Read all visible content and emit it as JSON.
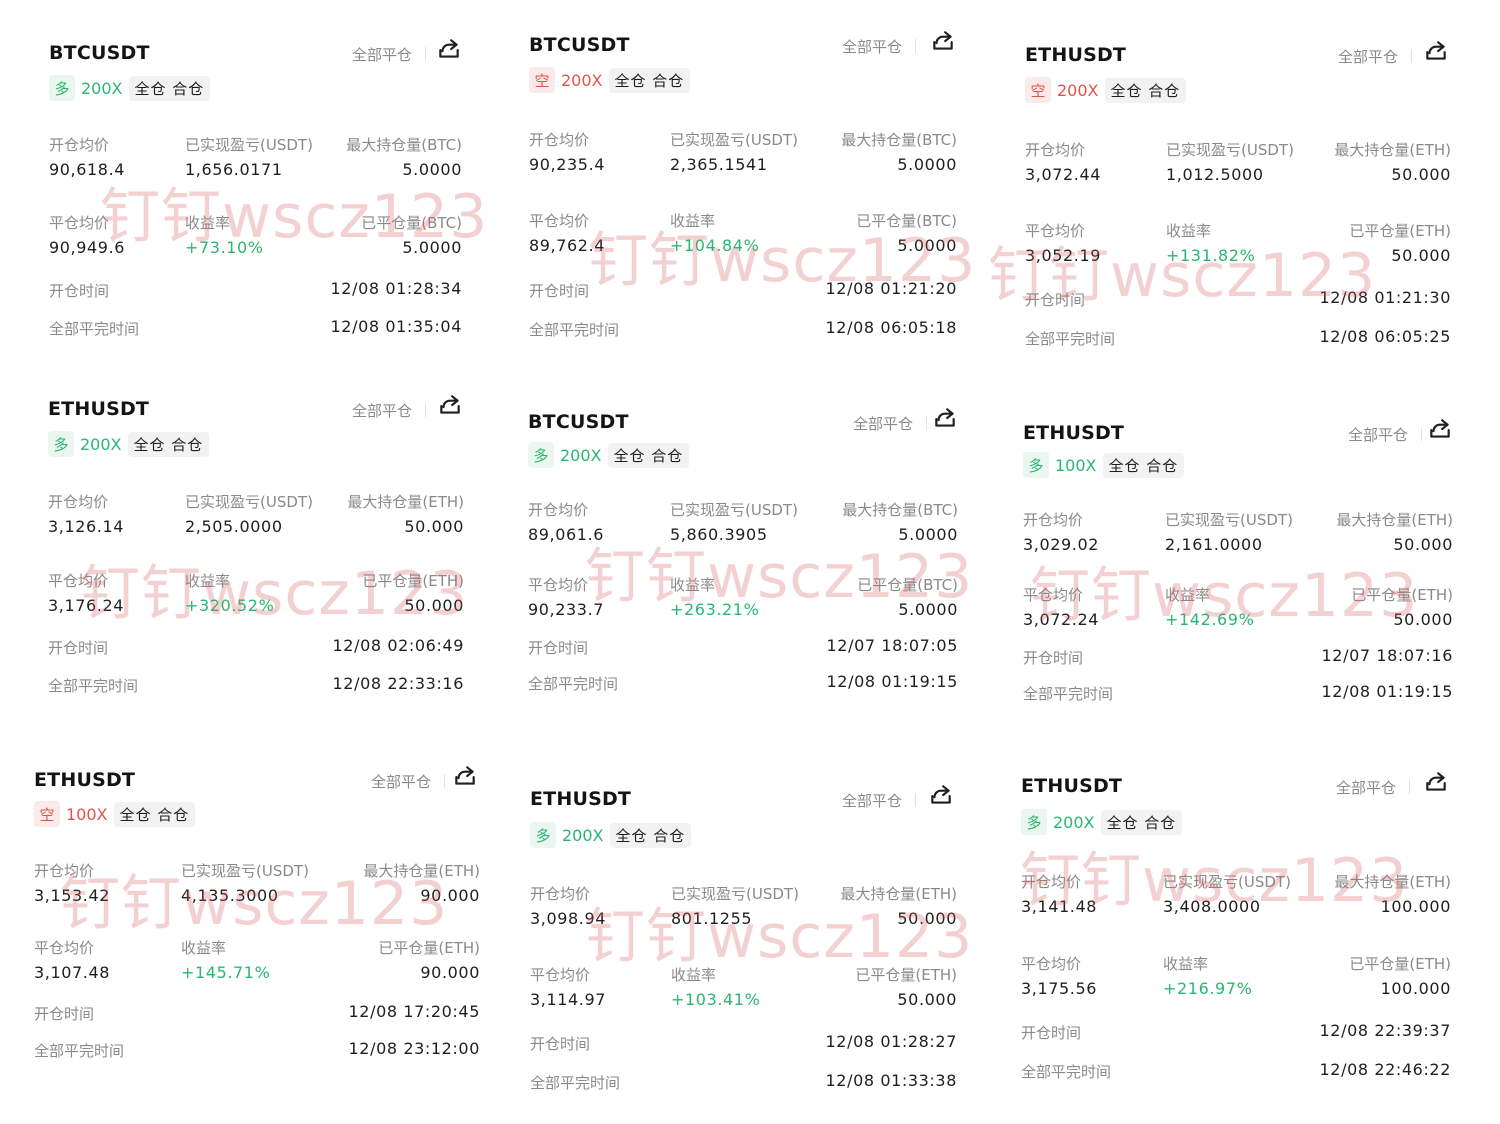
{
  "labels": {
    "close_all": "全部平仓",
    "open_avg": "开仓均价",
    "realized_pnl": "已实现盈亏(USDT)",
    "close_avg": "平仓均价",
    "yield": "收益率",
    "open_time": "开仓时间",
    "full_close_time": "全部平完时间",
    "margin_mode": "全仓 合仓"
  },
  "watermark": "钉钉wscz123",
  "colors": {
    "long": "#2bb673",
    "short": "#e0544e",
    "watermark": "#d65a5a"
  },
  "cards": [
    {
      "symbol": "BTCUSDT",
      "side": "多",
      "leverage": "200X",
      "open_avg": "90,618.4",
      "realized_pnl": "1,656.0171",
      "max_pos_label": "最大持仓量(BTC)",
      "max_pos": "5.0000",
      "close_avg": "90,949.6",
      "yield": "+73.10%",
      "closed_label": "已平仓量(BTC)",
      "closed_qty": "5.0000",
      "open_time": "12/08 01:28:34",
      "full_close_time": "12/08 01:35:04"
    },
    {
      "symbol": "BTCUSDT",
      "side": "空",
      "leverage": "200X",
      "open_avg": "90,235.4",
      "realized_pnl": "2,365.1541",
      "max_pos_label": "最大持仓量(BTC)",
      "max_pos": "5.0000",
      "close_avg": "89,762.4",
      "yield": "+104.84%",
      "closed_label": "已平仓量(BTC)",
      "closed_qty": "5.0000",
      "open_time": "12/08 01:21:20",
      "full_close_time": "12/08 06:05:18"
    },
    {
      "symbol": "ETHUSDT",
      "side": "空",
      "leverage": "200X",
      "open_avg": "3,072.44",
      "realized_pnl": "1,012.5000",
      "max_pos_label": "最大持仓量(ETH)",
      "max_pos": "50.000",
      "close_avg": "3,052.19",
      "yield": "+131.82%",
      "closed_label": "已平仓量(ETH)",
      "closed_qty": "50.000",
      "open_time": "12/08 01:21:30",
      "full_close_time": "12/08 06:05:25"
    },
    {
      "symbol": "ETHUSDT",
      "side": "多",
      "leverage": "200X",
      "open_avg": "3,126.14",
      "realized_pnl": "2,505.0000",
      "max_pos_label": "最大持仓量(ETH)",
      "max_pos": "50.000",
      "close_avg": "3,176.24",
      "yield": "+320.52%",
      "closed_label": "已平仓量(ETH)",
      "closed_qty": "50.000",
      "open_time": "12/08 02:06:49",
      "full_close_time": "12/08 22:33:16"
    },
    {
      "symbol": "BTCUSDT",
      "side": "多",
      "leverage": "200X",
      "open_avg": "89,061.6",
      "realized_pnl": "5,860.3905",
      "max_pos_label": "最大持仓量(BTC)",
      "max_pos": "5.0000",
      "close_avg": "90,233.7",
      "yield": "+263.21%",
      "closed_label": "已平仓量(BTC)",
      "closed_qty": "5.0000",
      "open_time": "12/07 18:07:05",
      "full_close_time": "12/08 01:19:15"
    },
    {
      "symbol": "ETHUSDT",
      "side": "多",
      "leverage": "100X",
      "open_avg": "3,029.02",
      "realized_pnl": "2,161.0000",
      "max_pos_label": "最大持仓量(ETH)",
      "max_pos": "50.000",
      "close_avg": "3,072.24",
      "yield": "+142.69%",
      "closed_label": "已平仓量(ETH)",
      "closed_qty": "50.000",
      "open_time": "12/07 18:07:16",
      "full_close_time": "12/08 01:19:15"
    },
    {
      "symbol": "ETHUSDT",
      "side": "空",
      "leverage": "100X",
      "open_avg": "3,153.42",
      "realized_pnl": "4,135.3000",
      "max_pos_label": "最大持仓量(ETH)",
      "max_pos": "90.000",
      "close_avg": "3,107.48",
      "yield": "+145.71%",
      "closed_label": "已平仓量(ETH)",
      "closed_qty": "90.000",
      "open_time": "12/08 17:20:45",
      "full_close_time": "12/08 23:12:00"
    },
    {
      "symbol": "ETHUSDT",
      "side": "多",
      "leverage": "200X",
      "open_avg": "3,098.94",
      "realized_pnl": "801.1255",
      "max_pos_label": "最大持仓量(ETH)",
      "max_pos": "50.000",
      "close_avg": "3,114.97",
      "yield": "+103.41%",
      "closed_label": "已平仓量(ETH)",
      "closed_qty": "50.000",
      "open_time": "12/08 01:28:27",
      "full_close_time": "12/08 01:33:38"
    },
    {
      "symbol": "ETHUSDT",
      "side": "多",
      "leverage": "200X",
      "open_avg": "3,141.48",
      "realized_pnl": "3,408.0000",
      "max_pos_label": "最大持仓量(ETH)",
      "max_pos": "100.000",
      "close_avg": "3,175.56",
      "yield": "+216.97%",
      "closed_label": "已平仓量(ETH)",
      "closed_qty": "100.000",
      "open_time": "12/08 22:39:37",
      "full_close_time": "12/08 22:46:22"
    }
  ]
}
